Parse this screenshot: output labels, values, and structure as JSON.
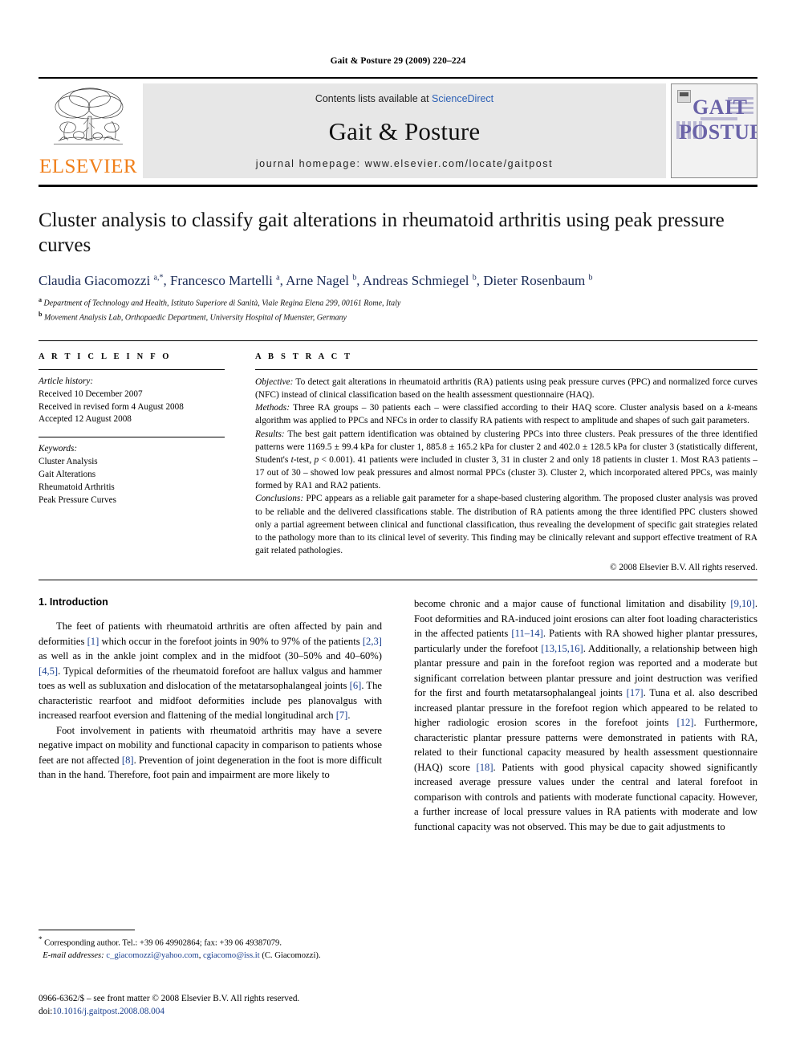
{
  "running_head": "Gait & Posture 29 (2009) 220–224",
  "masthead": {
    "publisher_name": "ELSEVIER",
    "contents_prefix": "Contents lists available at",
    "contents_link": "ScienceDirect",
    "journal_title": "Gait & Posture",
    "homepage_line": "journal homepage: www.elsevier.com/locate/gaitpost",
    "cover": {
      "line1": "GAIT",
      "line2": "POSTURE"
    }
  },
  "article": {
    "title": "Cluster analysis to classify gait alterations in rheumatoid arthritis using peak pressure curves",
    "authors_html": "Claudia Giacomozzi <sup>a,*</sup>, Francesco Martelli <sup>a</sup>, Arne Nagel <sup>b</sup>, Andreas Schmiegel <sup>b</sup>, Dieter Rosenbaum <sup>b</sup>",
    "affiliation_a": "Department of Technology and Health, Istituto Superiore di Sanità, Viale Regina Elena 299, 00161 Rome, Italy",
    "affiliation_b": "Movement Analysis Lab, Orthopaedic Department, University Hospital of Muenster, Germany"
  },
  "article_info": {
    "heading": "A R T I C L E  I N F O",
    "history_label": "Article history:",
    "history": [
      "Received 10 December 2007",
      "Received in revised form 4 August 2008",
      "Accepted 12 August 2008"
    ],
    "keywords_label": "Keywords:",
    "keywords": [
      "Cluster Analysis",
      "Gait Alterations",
      "Rheumatoid Arthritis",
      "Peak Pressure Curves"
    ]
  },
  "abstract": {
    "heading": "A B S T R A C T",
    "objective_label": "Objective:",
    "objective_text": " To detect gait alterations in rheumatoid arthritis (RA) patients using peak pressure curves (PPC) and normalized force curves (NFC) instead of clinical classification based on the health assessment questionnaire (HAQ).",
    "methods_label": "Methods:",
    "methods_text_1": " Three RA groups – 30 patients each – were classified according to their HAQ score. Cluster analysis based on a ",
    "methods_italic": "k",
    "methods_text_2": "-means algorithm was applied to PPCs and NFCs in order to classify RA patients with respect to amplitude and shapes of such gait parameters.",
    "results_label": "Results:",
    "results_text_1": " The best gait pattern identification was obtained by clustering PPCs into three clusters. Peak pressures of the three identified patterns were 1169.5 ± 99.4 kPa for cluster 1, 885.8 ± 165.2 kPa for cluster 2 and 402.0 ± 128.5 kPa for cluster 3 (statistically different, Student's ",
    "results_italic_1": "t",
    "results_text_2": "-test, ",
    "results_italic_2": "p",
    "results_text_3": " < 0.001). 41 patients were included in cluster 3, 31 in cluster 2 and only 18 patients in cluster 1. Most RA3 patients – 17 out of 30 – showed low peak pressures and almost normal PPCs (cluster 3). Cluster 2, which incorporated altered PPCs, was mainly formed by RA1 and RA2 patients.",
    "conclusions_label": "Conclusions:",
    "conclusions_text": " PPC appears as a reliable gait parameter for a shape-based clustering algorithm. The proposed cluster analysis was proved to be reliable and the delivered classifications stable. The distribution of RA patients among the three identified PPC clusters showed only a partial agreement between clinical and functional classification, thus revealing the development of specific gait strategies related to the pathology more than to its clinical level of severity. This finding may be clinically relevant and support effective treatment of RA gait related pathologies.",
    "copyright": "© 2008 Elsevier B.V. All rights reserved."
  },
  "introduction": {
    "heading": "1. Introduction",
    "left_para_1": [
      "The feet of patients with rheumatoid arthritis are often affected by pain and deformities ",
      "[1]",
      " which occur in the forefoot joints in 90% to 97% of the patients ",
      "[2,3]",
      " as well as in the ankle joint complex and in the midfoot (30–50% and 40–60%) ",
      "[4,5]",
      ". Typical deformities of the rheumatoid forefoot are hallux valgus and hammer toes as well as subluxation and dislocation of the metatarsophalangeal joints ",
      "[6]",
      ". The characteristic rearfoot and midfoot deformities include pes planovalgus with increased rearfoot eversion and flattening of the medial longitudinal arch ",
      "[7]",
      "."
    ],
    "left_para_2": [
      "Foot involvement in patients with rheumatoid arthritis may have a severe negative impact on mobility and functional capacity in comparison to patients whose feet are not affected ",
      "[8]",
      ". Prevention of joint degeneration in the foot is more difficult than in the hand. Therefore, foot pain and impairment are more likely to"
    ],
    "right_para_1": [
      "become chronic and a major cause of functional limitation and disability ",
      "[9,10]",
      ". Foot deformities and RA-induced joint erosions can alter foot loading characteristics in the affected patients ",
      "[11–14]",
      ". Patients with RA showed higher plantar pressures, particularly under the forefoot ",
      "[13,15,16]",
      ". Additionally, a relationship between high plantar pressure and pain in the forefoot region was reported and a moderate but significant correlation between plantar pressure and joint destruction was verified for the first and fourth metatarsophalangeal joints ",
      "[17]",
      ". Tuna et al. also described increased plantar pressure in the forefoot region which appeared to be related to higher radiologic erosion scores in the forefoot joints ",
      "[12]",
      ". Furthermore, characteristic plantar pressure patterns were demonstrated in patients with RA, related to their functional capacity measured by health assessment questionnaire (HAQ) score ",
      "[18]",
      ". Patients with good physical capacity showed significantly increased average pressure values under the central and lateral forefoot in comparison with controls and patients with moderate functional capacity. However, a further increase of local pressure values in RA patients with moderate and low functional capacity was not observed. This may be due to gait adjustments to"
    ]
  },
  "footnotes": {
    "corresponding_star": "*",
    "corresponding_text": " Corresponding author. Tel.: +39 06 49902864; fax: +39 06 49387079.",
    "email_label": "E-mail addresses:",
    "email_1": "c_giacomozzi@yahoo.com",
    "email_sep": ", ",
    "email_2": "cgiacomo@iss.it",
    "email_suffix": " (C. Giacomozzi)."
  },
  "imprint": {
    "issn_line": "0966-6362/$ – see front matter © 2008 Elsevier B.V. All rights reserved.",
    "doi_label": "doi:",
    "doi_value": "10.1016/j.gaitpost.2008.08.004"
  }
}
